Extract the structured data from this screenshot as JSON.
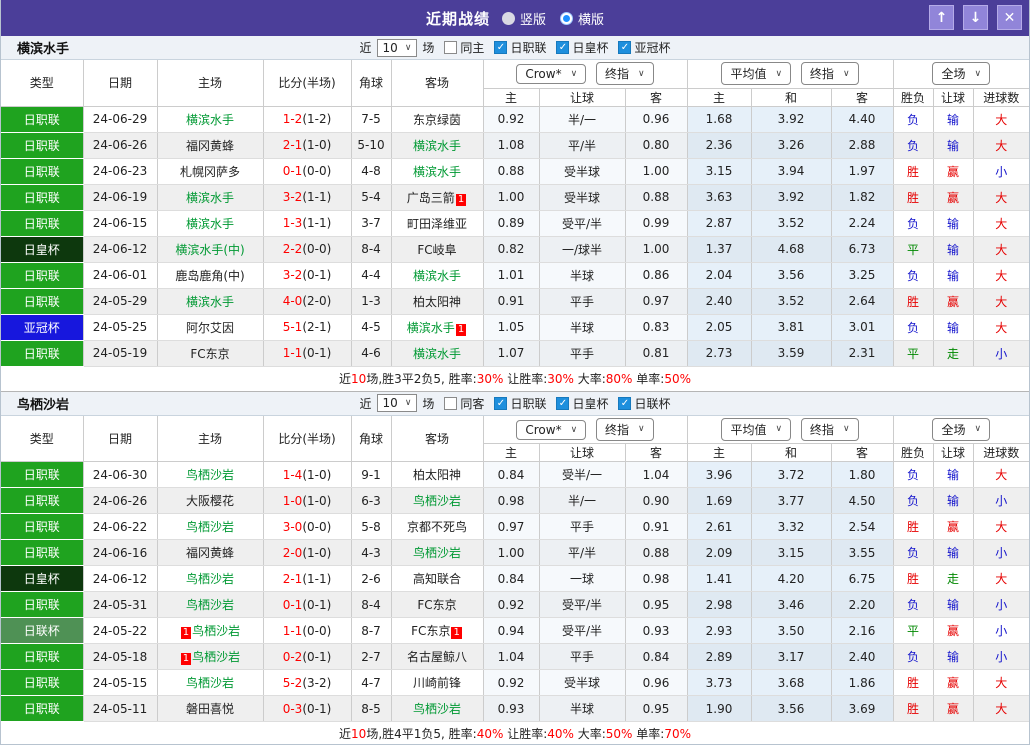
{
  "icons": {
    "check": "✓",
    "chevron": "∨",
    "arrow_up": "↑",
    "arrow_down": "↓",
    "close": "✕"
  },
  "titlebar": {
    "title": "近期战绩",
    "radio_vertical": "竖版",
    "radio_horizontal": "横版",
    "selected": "横版"
  },
  "colors": {
    "titlebar_bg": "#4b3e99",
    "league": {
      "日职联": "#1fa31f",
      "日皇杯": "#0d380d",
      "亚冠杯": "#1717dd",
      "日联杯": "#4f9155"
    },
    "team_highlight": "#009933",
    "score_red": "#ff0000",
    "result_red": "#e60000",
    "result_blue": "#1414cc",
    "result_green": "#008800"
  },
  "table_header": {
    "col_type": "类型",
    "col_date": "日期",
    "col_home": "主场",
    "col_score": "比分(半场)",
    "col_corner": "角球",
    "col_away": "客场",
    "dd_crow": "Crow*",
    "dd_final1": "终指",
    "dd_avg": "平均值",
    "dd_final2": "终指",
    "dd_full": "全场",
    "sub_home": "主",
    "sub_handicap": "让球",
    "sub_away": "客",
    "sub_home2": "主",
    "sub_draw": "和",
    "sub_away2": "客",
    "sub_result": "胜负",
    "sub_rq": "让球",
    "sub_goals": "进球数"
  },
  "sections": [
    {
      "team": "横滨水手",
      "filter": {
        "prefix": "近",
        "count": "10",
        "suffix": "场",
        "same_label": "同主",
        "same_checked": false,
        "leagues": [
          {
            "label": "日职联",
            "checked": true
          },
          {
            "label": "日皇杯",
            "checked": true
          },
          {
            "label": "亚冠杯",
            "checked": true
          }
        ]
      },
      "rows": [
        {
          "league": "日职联",
          "date": "24-06-29",
          "home": "横滨水手",
          "home_green": true,
          "score": "1-2",
          "half": "(1-2)",
          "corner": "7-5",
          "away": "东京绿茵",
          "away_green": false,
          "crow": [
            "0.92",
            "半/一",
            "0.96"
          ],
          "avg": [
            "1.68",
            "3.92",
            "4.40"
          ],
          "res": [
            [
              "负",
              "b"
            ],
            [
              "输",
              "b"
            ],
            [
              "大",
              "r"
            ]
          ]
        },
        {
          "league": "日职联",
          "date": "24-06-26",
          "home": "福冈黄蜂",
          "home_green": false,
          "score": "2-1",
          "half": "(1-0)",
          "corner": "5-10",
          "away": "横滨水手",
          "away_green": true,
          "crow": [
            "1.08",
            "平/半",
            "0.80"
          ],
          "avg": [
            "2.36",
            "3.26",
            "2.88"
          ],
          "res": [
            [
              "负",
              "b"
            ],
            [
              "输",
              "b"
            ],
            [
              "大",
              "r"
            ]
          ]
        },
        {
          "league": "日职联",
          "date": "24-06-23",
          "home": "札幌冈萨多",
          "home_green": false,
          "score": "0-1",
          "half": "(0-0)",
          "corner": "4-8",
          "away": "横滨水手",
          "away_green": true,
          "crow": [
            "0.88",
            "受半球",
            "1.00"
          ],
          "avg": [
            "3.15",
            "3.94",
            "1.97"
          ],
          "res": [
            [
              "胜",
              "r"
            ],
            [
              "赢",
              "r"
            ],
            [
              "小",
              "b"
            ]
          ]
        },
        {
          "league": "日职联",
          "date": "24-06-19",
          "home": "横滨水手",
          "home_green": true,
          "score": "3-2",
          "half": "(1-1)",
          "corner": "5-4",
          "away": "广岛三箭",
          "away_green": false,
          "away_badge": "1",
          "crow": [
            "1.00",
            "受半球",
            "0.88"
          ],
          "avg": [
            "3.63",
            "3.92",
            "1.82"
          ],
          "res": [
            [
              "胜",
              "r"
            ],
            [
              "赢",
              "r"
            ],
            [
              "大",
              "r"
            ]
          ]
        },
        {
          "league": "日职联",
          "date": "24-06-15",
          "home": "横滨水手",
          "home_green": true,
          "score": "1-3",
          "half": "(1-1)",
          "corner": "3-7",
          "away": "町田泽维亚",
          "away_green": false,
          "crow": [
            "0.89",
            "受平/半",
            "0.99"
          ],
          "avg": [
            "2.87",
            "3.52",
            "2.24"
          ],
          "res": [
            [
              "负",
              "b"
            ],
            [
              "输",
              "b"
            ],
            [
              "大",
              "r"
            ]
          ]
        },
        {
          "league": "日皇杯",
          "date": "24-06-12",
          "home": "横滨水手(中)",
          "home_green": true,
          "score": "2-2",
          "half": "(0-0)",
          "corner": "8-4",
          "away": "FC岐阜",
          "away_green": false,
          "crow": [
            "0.82",
            "一/球半",
            "1.00"
          ],
          "avg": [
            "1.37",
            "4.68",
            "6.73"
          ],
          "res": [
            [
              "平",
              "g"
            ],
            [
              "输",
              "b"
            ],
            [
              "大",
              "r"
            ]
          ]
        },
        {
          "league": "日职联",
          "date": "24-06-01",
          "home": "鹿岛鹿角(中)",
          "home_green": false,
          "score": "3-2",
          "half": "(0-1)",
          "corner": "4-4",
          "away": "横滨水手",
          "away_green": true,
          "crow": [
            "1.01",
            "半球",
            "0.86"
          ],
          "avg": [
            "2.04",
            "3.56",
            "3.25"
          ],
          "res": [
            [
              "负",
              "b"
            ],
            [
              "输",
              "b"
            ],
            [
              "大",
              "r"
            ]
          ]
        },
        {
          "league": "日职联",
          "date": "24-05-29",
          "home": "横滨水手",
          "home_green": true,
          "score": "4-0",
          "half": "(2-0)",
          "corner": "1-3",
          "away": "柏太阳神",
          "away_green": false,
          "crow": [
            "0.91",
            "平手",
            "0.97"
          ],
          "avg": [
            "2.40",
            "3.52",
            "2.64"
          ],
          "res": [
            [
              "胜",
              "r"
            ],
            [
              "赢",
              "r"
            ],
            [
              "大",
              "r"
            ]
          ]
        },
        {
          "league": "亚冠杯",
          "date": "24-05-25",
          "home": "阿尔艾因",
          "home_green": false,
          "score": "5-1",
          "half": "(2-1)",
          "corner": "4-5",
          "away": "横滨水手",
          "away_green": true,
          "away_badge": "1",
          "crow": [
            "1.05",
            "半球",
            "0.83"
          ],
          "avg": [
            "2.05",
            "3.81",
            "3.01"
          ],
          "res": [
            [
              "负",
              "b"
            ],
            [
              "输",
              "b"
            ],
            [
              "大",
              "r"
            ]
          ]
        },
        {
          "league": "日职联",
          "date": "24-05-19",
          "home": "FC东京",
          "home_green": false,
          "score": "1-1",
          "half": "(0-1)",
          "corner": "4-6",
          "away": "横滨水手",
          "away_green": true,
          "crow": [
            "1.07",
            "平手",
            "0.81"
          ],
          "avg": [
            "2.73",
            "3.59",
            "2.31"
          ],
          "res": [
            [
              "平",
              "g"
            ],
            [
              "走",
              "g"
            ],
            [
              "小",
              "b"
            ]
          ]
        }
      ],
      "summary": [
        [
          "近",
          "k"
        ],
        [
          "10",
          "r"
        ],
        [
          "场,胜3平2负5, 胜率:",
          "k"
        ],
        [
          "30%",
          "r"
        ],
        [
          " 让胜率:",
          "k"
        ],
        [
          "30%",
          "r"
        ],
        [
          " 大率:",
          "k"
        ],
        [
          "80%",
          "r"
        ],
        [
          " 单率:",
          "k"
        ],
        [
          "50%",
          "r"
        ]
      ]
    },
    {
      "team": "鸟栖沙岩",
      "filter": {
        "prefix": "近",
        "count": "10",
        "suffix": "场",
        "same_label": "同客",
        "same_checked": false,
        "leagues": [
          {
            "label": "日职联",
            "checked": true
          },
          {
            "label": "日皇杯",
            "checked": true
          },
          {
            "label": "日联杯",
            "checked": true
          }
        ]
      },
      "rows": [
        {
          "league": "日职联",
          "date": "24-06-30",
          "home": "鸟栖沙岩",
          "home_green": true,
          "score": "1-4",
          "half": "(1-0)",
          "corner": "9-1",
          "away": "柏太阳神",
          "away_green": false,
          "crow": [
            "0.84",
            "受半/一",
            "1.04"
          ],
          "avg": [
            "3.96",
            "3.72",
            "1.80"
          ],
          "res": [
            [
              "负",
              "b"
            ],
            [
              "输",
              "b"
            ],
            [
              "大",
              "r"
            ]
          ]
        },
        {
          "league": "日职联",
          "date": "24-06-26",
          "home": "大阪樱花",
          "home_green": false,
          "score": "1-0",
          "half": "(1-0)",
          "corner": "6-3",
          "away": "鸟栖沙岩",
          "away_green": true,
          "crow": [
            "0.98",
            "半/一",
            "0.90"
          ],
          "avg": [
            "1.69",
            "3.77",
            "4.50"
          ],
          "res": [
            [
              "负",
              "b"
            ],
            [
              "输",
              "b"
            ],
            [
              "小",
              "b"
            ]
          ]
        },
        {
          "league": "日职联",
          "date": "24-06-22",
          "home": "鸟栖沙岩",
          "home_green": true,
          "score": "3-0",
          "half": "(0-0)",
          "corner": "5-8",
          "away": "京都不死鸟",
          "away_green": false,
          "crow": [
            "0.97",
            "平手",
            "0.91"
          ],
          "avg": [
            "2.61",
            "3.32",
            "2.54"
          ],
          "res": [
            [
              "胜",
              "r"
            ],
            [
              "赢",
              "r"
            ],
            [
              "大",
              "r"
            ]
          ]
        },
        {
          "league": "日职联",
          "date": "24-06-16",
          "home": "福冈黄蜂",
          "home_green": false,
          "score": "2-0",
          "half": "(1-0)",
          "corner": "4-3",
          "away": "鸟栖沙岩",
          "away_green": true,
          "crow": [
            "1.00",
            "平/半",
            "0.88"
          ],
          "avg": [
            "2.09",
            "3.15",
            "3.55"
          ],
          "res": [
            [
              "负",
              "b"
            ],
            [
              "输",
              "b"
            ],
            [
              "小",
              "b"
            ]
          ]
        },
        {
          "league": "日皇杯",
          "date": "24-06-12",
          "home": "鸟栖沙岩",
          "home_green": true,
          "score": "2-1",
          "half": "(1-1)",
          "corner": "2-6",
          "away": "高知联合",
          "away_green": false,
          "crow": [
            "0.84",
            "一球",
            "0.98"
          ],
          "avg": [
            "1.41",
            "4.20",
            "6.75"
          ],
          "res": [
            [
              "胜",
              "r"
            ],
            [
              "走",
              "g"
            ],
            [
              "大",
              "r"
            ]
          ]
        },
        {
          "league": "日职联",
          "date": "24-05-31",
          "home": "鸟栖沙岩",
          "home_green": true,
          "score": "0-1",
          "half": "(0-1)",
          "corner": "8-4",
          "away": "FC东京",
          "away_green": false,
          "crow": [
            "0.92",
            "受平/半",
            "0.95"
          ],
          "avg": [
            "2.98",
            "3.46",
            "2.20"
          ],
          "res": [
            [
              "负",
              "b"
            ],
            [
              "输",
              "b"
            ],
            [
              "小",
              "b"
            ]
          ]
        },
        {
          "league": "日联杯",
          "date": "24-05-22",
          "home": "鸟栖沙岩",
          "home_green": true,
          "home_badge_pre": "1",
          "score": "1-1",
          "half": "(0-0)",
          "corner": "8-7",
          "away": "FC东京",
          "away_green": false,
          "away_badge": "1",
          "crow": [
            "0.94",
            "受平/半",
            "0.93"
          ],
          "avg": [
            "2.93",
            "3.50",
            "2.16"
          ],
          "res": [
            [
              "平",
              "g"
            ],
            [
              "赢",
              "r"
            ],
            [
              "小",
              "b"
            ]
          ]
        },
        {
          "league": "日职联",
          "date": "24-05-18",
          "home": "鸟栖沙岩",
          "home_green": true,
          "home_badge_pre": "1",
          "score": "0-2",
          "half": "(0-1)",
          "corner": "2-7",
          "away": "名古屋鲸八",
          "away_green": false,
          "crow": [
            "1.04",
            "平手",
            "0.84"
          ],
          "avg": [
            "2.89",
            "3.17",
            "2.40"
          ],
          "res": [
            [
              "负",
              "b"
            ],
            [
              "输",
              "b"
            ],
            [
              "小",
              "b"
            ]
          ]
        },
        {
          "league": "日职联",
          "date": "24-05-15",
          "home": "鸟栖沙岩",
          "home_green": true,
          "score": "5-2",
          "half": "(3-2)",
          "corner": "4-7",
          "away": "川崎前锋",
          "away_green": false,
          "crow": [
            "0.92",
            "受半球",
            "0.96"
          ],
          "avg": [
            "3.73",
            "3.68",
            "1.86"
          ],
          "res": [
            [
              "胜",
              "r"
            ],
            [
              "赢",
              "r"
            ],
            [
              "大",
              "r"
            ]
          ]
        },
        {
          "league": "日职联",
          "date": "24-05-11",
          "home": "磐田喜悦",
          "home_green": false,
          "score": "0-3",
          "half": "(0-1)",
          "corner": "8-5",
          "away": "鸟栖沙岩",
          "away_green": true,
          "crow": [
            "0.93",
            "半球",
            "0.95"
          ],
          "avg": [
            "1.90",
            "3.56",
            "3.69"
          ],
          "res": [
            [
              "胜",
              "r"
            ],
            [
              "赢",
              "r"
            ],
            [
              "大",
              "r"
            ]
          ]
        }
      ],
      "summary": [
        [
          "近",
          "k"
        ],
        [
          "10",
          "r"
        ],
        [
          "场,胜4平1负5, 胜率:",
          "k"
        ],
        [
          "40%",
          "r"
        ],
        [
          " 让胜率:",
          "k"
        ],
        [
          "40%",
          "r"
        ],
        [
          " 大率:",
          "k"
        ],
        [
          "50%",
          "r"
        ],
        [
          " 单率:",
          "k"
        ],
        [
          "70%",
          "r"
        ]
      ]
    }
  ]
}
